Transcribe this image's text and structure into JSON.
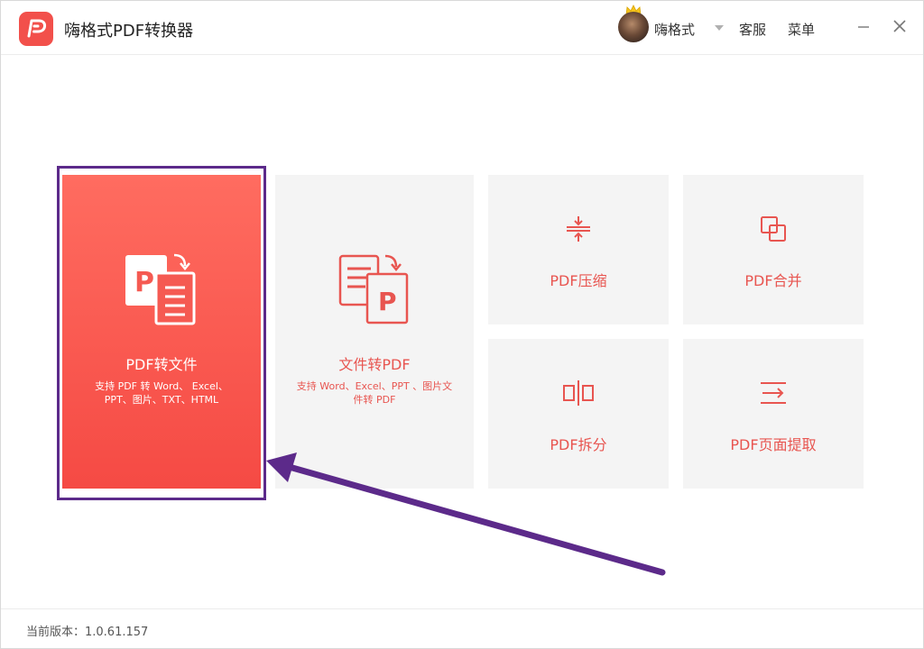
{
  "app": {
    "title": "嗨格式PDF转换器",
    "brand_color": "#f2504b",
    "logo_icon": "pdf-logo-icon"
  },
  "header": {
    "username": "嗨格式",
    "avatar_icon": "crown-icon",
    "service_label": "客服",
    "menu_label": "菜单"
  },
  "tiles": {
    "pdf_to_file": {
      "title": "PDF转文件",
      "desc_line1": "支持 PDF 转 Word、 Excel、",
      "desc_line2": "PPT、图片、TXT、HTML",
      "icon": "pdf-to-file-icon",
      "selected": true
    },
    "file_to_pdf": {
      "title": "文件转PDF",
      "desc_line1": "支持 Word、Excel、PPT 、图片文",
      "desc_line2": "件转 PDF",
      "icon": "file-to-pdf-icon"
    },
    "compress": {
      "title": "PDF压缩",
      "icon": "compress-icon"
    },
    "merge": {
      "title": "PDF合并",
      "icon": "merge-icon"
    },
    "split": {
      "title": "PDF拆分",
      "icon": "split-icon"
    },
    "extract": {
      "title": "PDF页面提取",
      "icon": "extract-icon"
    }
  },
  "footer": {
    "version_text": "当前版本：1.0.61.157"
  },
  "colors": {
    "accent": "#e85550",
    "selection_frame": "#5c2a8a",
    "annotation_arrow": "#5c2a8a"
  }
}
